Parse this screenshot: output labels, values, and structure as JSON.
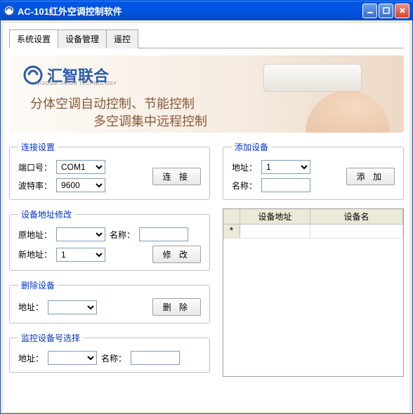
{
  "window": {
    "title": "AC-101红外空调控制软件"
  },
  "tabs": [
    {
      "label": "系统设置",
      "active": true
    },
    {
      "label": "设备管理",
      "active": false
    },
    {
      "label": "遥控",
      "active": false
    }
  ],
  "banner": {
    "logo_text": "汇智联合",
    "logo_sub": "WISDOM UNION TECHNOLOGY",
    "line1": "分体空调自动控制、节能控制",
    "line2": "多空调集中远程控制"
  },
  "connection": {
    "legend": "连接设置",
    "port_label": "端口号：",
    "port_value": "COM1",
    "baud_label": "波特率：",
    "baud_value": "9600",
    "connect_button": "连 接"
  },
  "add_device": {
    "legend": "添加设备",
    "addr_label": "地址：",
    "addr_value": "1",
    "name_label": "名称：",
    "name_value": "",
    "add_button": "添 加"
  },
  "modify_addr": {
    "legend": "设备地址修改",
    "old_addr_label": "原地址：",
    "old_addr_value": "",
    "name_label": "名称：",
    "name_value": "",
    "new_addr_label": "新地址：",
    "new_addr_value": "1",
    "modify_button": "修 改"
  },
  "delete_device": {
    "legend": "删除设备",
    "addr_label": "地址：",
    "addr_value": "",
    "delete_button": "删 除"
  },
  "monitor_select": {
    "legend": "监控设备号选择",
    "addr_label": "地址：",
    "addr_value": "",
    "name_label": "名称：",
    "name_value": ""
  },
  "grid": {
    "col_addr": "设备地址",
    "col_name": "设备名",
    "row_marker": "*"
  }
}
